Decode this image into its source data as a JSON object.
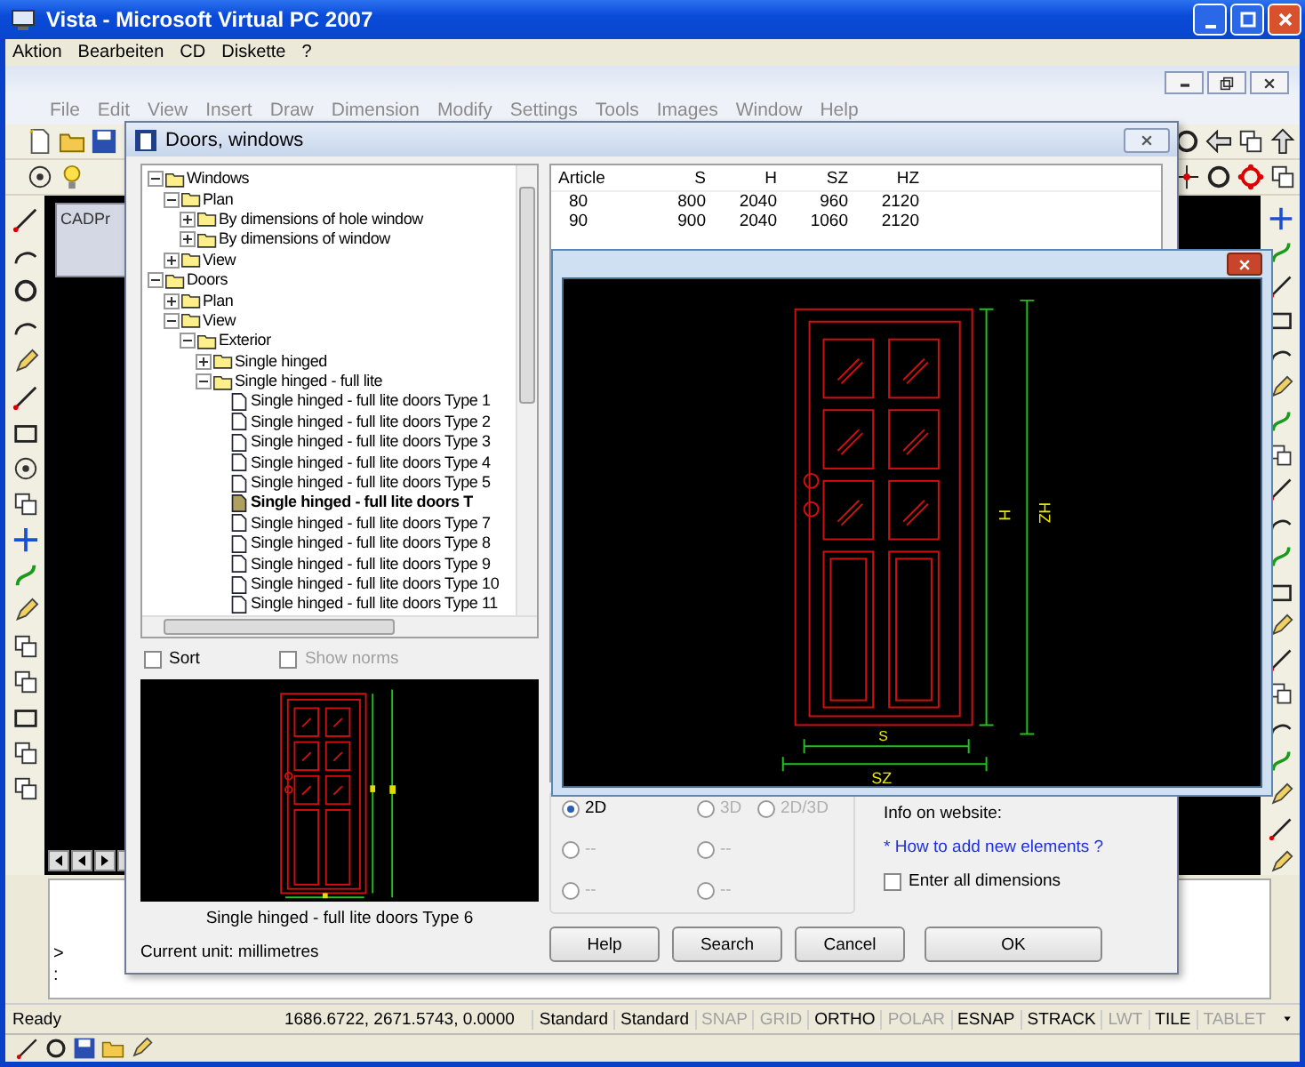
{
  "host_window": {
    "title": "Vista - Microsoft Virtual PC 2007",
    "menu": [
      "Aktion",
      "Bearbeiten",
      "CD",
      "Diskette",
      "?"
    ]
  },
  "cad_app": {
    "menu": [
      "File",
      "Edit",
      "View",
      "Insert",
      "Draw",
      "Dimension",
      "Modify",
      "Settings",
      "Tools",
      "Images",
      "Window",
      "Help"
    ],
    "background_window_title": "CADPr",
    "command_lines": [
      ">",
      ":"
    ],
    "status": {
      "text": "Ready",
      "coordinates": "1686.6722, 2671.5743, 0.0000",
      "toggles": [
        {
          "label": "Standard",
          "on": true
        },
        {
          "label": "Standard",
          "on": true
        },
        {
          "label": "SNAP",
          "on": false
        },
        {
          "label": "GRID",
          "on": false
        },
        {
          "label": "ORTHO",
          "on": true
        },
        {
          "label": "POLAR",
          "on": false
        },
        {
          "label": "ESNAP",
          "on": true
        },
        {
          "label": "STRACK",
          "on": true
        },
        {
          "label": "LWT",
          "on": false
        },
        {
          "label": "TILE",
          "on": true
        },
        {
          "label": "TABLET",
          "on": false
        }
      ]
    }
  },
  "dialog": {
    "title": "Doors, windows",
    "tree": [
      {
        "label": "Windows",
        "kind": "folder",
        "expanded": true,
        "children": [
          {
            "label": "Plan",
            "kind": "folder",
            "expanded": true,
            "children": [
              {
                "label": "By dimensions of hole window",
                "kind": "folder",
                "expanded": false
              },
              {
                "label": "By dimensions of window",
                "kind": "folder",
                "expanded": false
              }
            ]
          },
          {
            "label": "View",
            "kind": "folder",
            "expanded": false
          }
        ]
      },
      {
        "label": "Doors",
        "kind": "folder",
        "expanded": true,
        "children": [
          {
            "label": "Plan",
            "kind": "folder",
            "expanded": false
          },
          {
            "label": "View",
            "kind": "folder",
            "expanded": true,
            "children": [
              {
                "label": "Exterior",
                "kind": "folder",
                "expanded": true,
                "children": [
                  {
                    "label": "Single hinged",
                    "kind": "folder",
                    "expanded": false
                  },
                  {
                    "label": "Single hinged - full lite",
                    "kind": "folder",
                    "expanded": true,
                    "children": [
                      {
                        "label": "Single hinged - full lite doors Type  1",
                        "kind": "file",
                        "selected": false
                      },
                      {
                        "label": "Single hinged - full lite doors Type  2",
                        "kind": "file",
                        "selected": false
                      },
                      {
                        "label": "Single hinged - full lite doors Type  3",
                        "kind": "file",
                        "selected": false
                      },
                      {
                        "label": "Single hinged - full lite doors Type  4",
                        "kind": "file",
                        "selected": false
                      },
                      {
                        "label": "Single hinged - full lite doors Type  5",
                        "kind": "file",
                        "selected": false
                      },
                      {
                        "label": "Single hinged - full lite doors T",
                        "kind": "file",
                        "selected": true
                      },
                      {
                        "label": "Single hinged - full lite doors Type  7",
                        "kind": "file",
                        "selected": false
                      },
                      {
                        "label": "Single hinged - full lite doors Type  8",
                        "kind": "file",
                        "selected": false
                      },
                      {
                        "label": "Single hinged - full lite doors Type  9",
                        "kind": "file",
                        "selected": false
                      },
                      {
                        "label": "Single hinged - full lite doors Type 10",
                        "kind": "file",
                        "selected": false
                      },
                      {
                        "label": "Single hinged - full lite doors Type 11",
                        "kind": "file",
                        "selected": false
                      }
                    ]
                  }
                ]
              }
            ]
          }
        ]
      }
    ],
    "options": [
      {
        "label": "Sort",
        "checked": false,
        "disabled": false
      },
      {
        "label": "Show norms",
        "checked": false,
        "disabled": true
      }
    ],
    "preview_caption": "Single hinged - full lite doors Type  6",
    "unit_text": "Current unit: millimetres",
    "table": {
      "columns": [
        "Article",
        "S",
        "H",
        "SZ",
        "HZ"
      ],
      "rows": [
        [
          "80",
          "800",
          "2040",
          "960",
          "2120"
        ],
        [
          "90",
          "900",
          "2040",
          "1060",
          "2120"
        ]
      ]
    },
    "view_modes": [
      {
        "label": "2D",
        "selected": true,
        "disabled": false
      },
      {
        "label": "3D",
        "selected": false,
        "disabled": true
      },
      {
        "label": "2D/3D",
        "selected": false,
        "disabled": true
      },
      {
        "label": "--",
        "selected": false,
        "disabled": true
      },
      {
        "label": "--",
        "selected": false,
        "disabled": true
      },
      {
        "label": "--",
        "selected": false,
        "disabled": true
      },
      {
        "label": "--",
        "selected": false,
        "disabled": true
      }
    ],
    "info_label": "Info on website:",
    "info_link": "* How to add new elements ?",
    "enter_all_dimensions": {
      "label": "Enter all dimensions",
      "checked": false
    },
    "buttons": [
      "Help",
      "Search",
      "Cancel",
      "OK"
    ]
  },
  "preview_window": {
    "labels": {
      "height": "H",
      "height_total": "HZ",
      "width": "S",
      "width_total": "SZ"
    }
  }
}
